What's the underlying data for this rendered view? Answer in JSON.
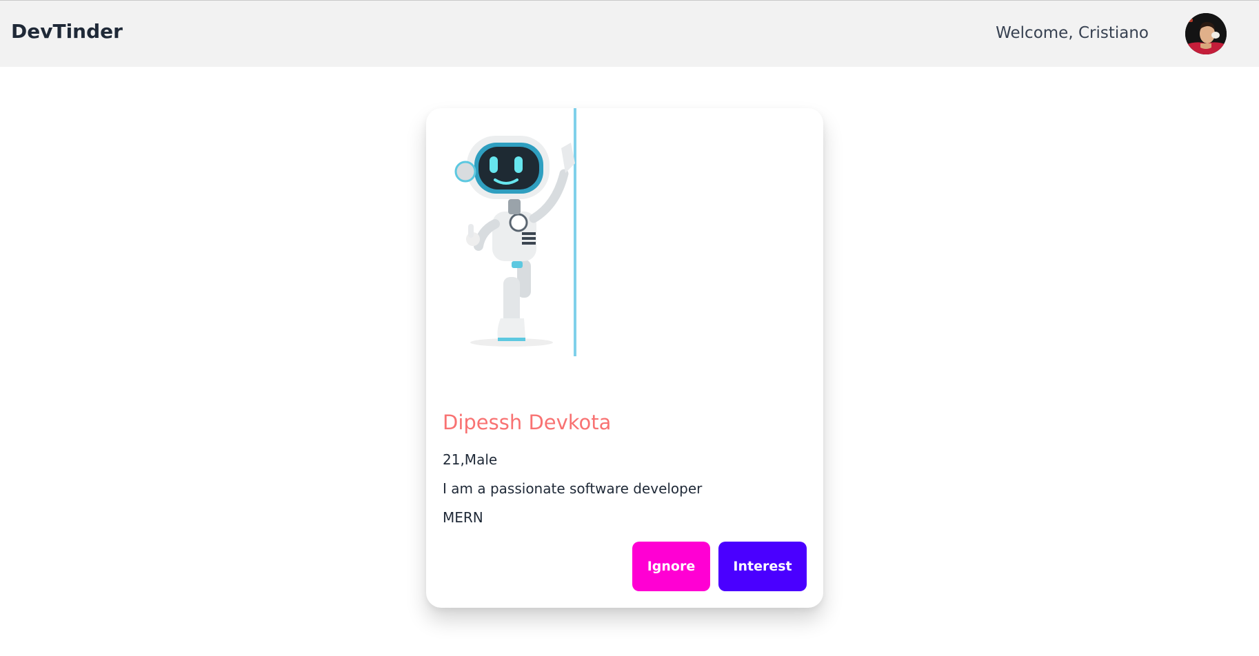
{
  "navbar": {
    "brand": "DevTinder",
    "welcome_text": "Welcome, Cristiano"
  },
  "feed_card": {
    "name": "Dipessh Devkota",
    "age_gender": "21,Male",
    "about": "I am a passionate software developer",
    "skills": "MERN",
    "actions": {
      "ignore_label": "Ignore",
      "interest_label": "Interest"
    }
  },
  "colors": {
    "navbar_bg": "#f2f2f2",
    "name": "#f87272",
    "ignore_button": "#ff00d3",
    "interest_button": "#4a00ff",
    "robot_accent": "#5cc8e0"
  }
}
